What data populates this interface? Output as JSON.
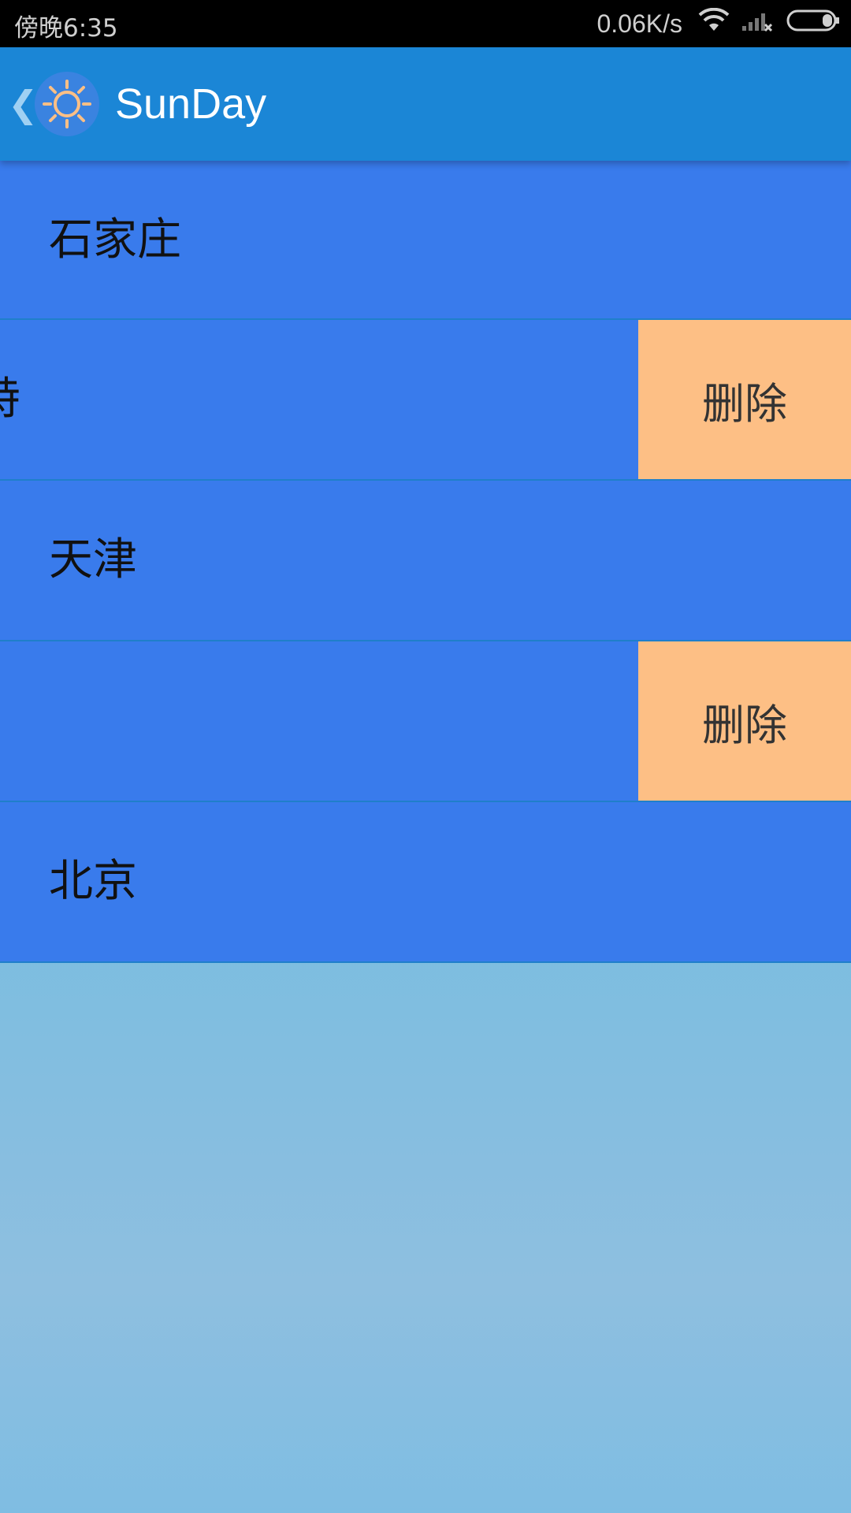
{
  "status_bar": {
    "time": "傍晚6:35",
    "net_speed": "0.06K/s",
    "icons": [
      "wifi-icon",
      "signal-icon",
      "battery-icon"
    ]
  },
  "toolbar": {
    "back_icon": "back-icon",
    "logo_icon": "sun-icon",
    "title": "SunDay",
    "color": "#1b86d6"
  },
  "city_list": {
    "items": [
      {
        "name": "石家庄",
        "swiped": false
      },
      {
        "name": "呼和浩特",
        "swiped": true,
        "delete_label": "删除"
      },
      {
        "name": "天津",
        "swiped": false
      },
      {
        "name": "",
        "swiped": true,
        "delete_label": "删除"
      },
      {
        "name": "北京",
        "swiped": false
      }
    ],
    "row_color": "#397bec",
    "delete_color": "#fdbf85"
  }
}
